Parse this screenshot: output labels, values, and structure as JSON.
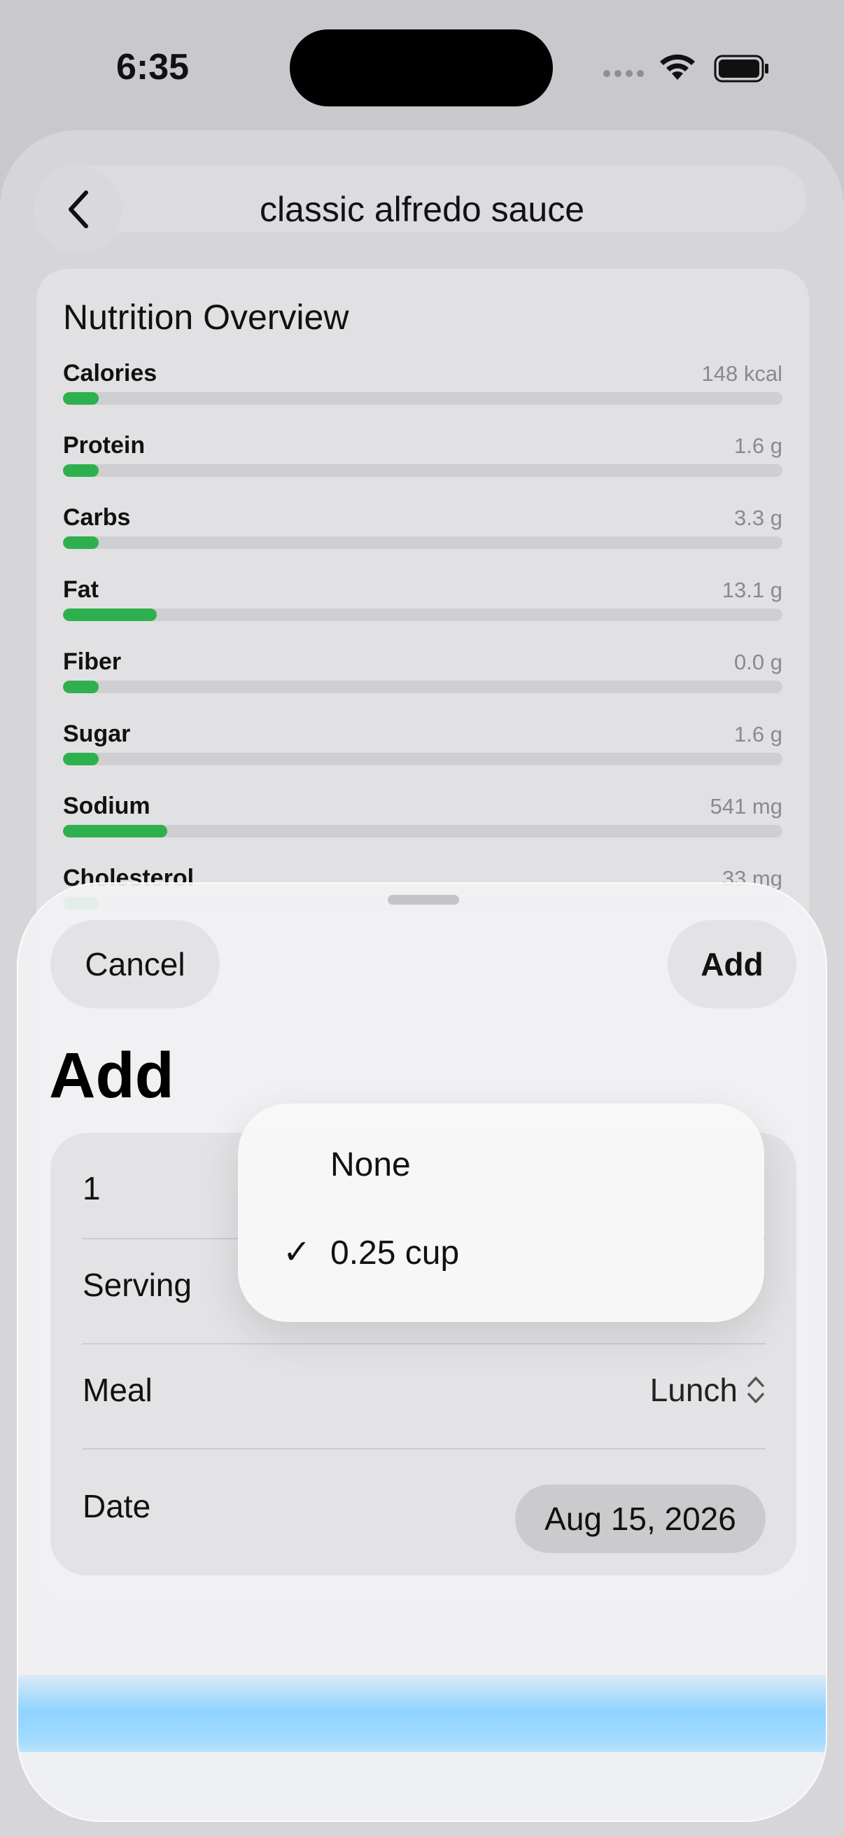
{
  "status_bar": {
    "time": "6:35"
  },
  "header": {
    "title": "classic alfredo sauce",
    "back_icon": "chevron-left-icon"
  },
  "nutrition": {
    "title": "Nutrition Overview",
    "rows": [
      {
        "label": "Calories",
        "value": "148 kcal",
        "fill": 0.05
      },
      {
        "label": "Protein",
        "value": "1.6 g",
        "fill": 0.05
      },
      {
        "label": "Carbs",
        "value": "3.3 g",
        "fill": 0.05
      },
      {
        "label": "Fat",
        "value": "13.1 g",
        "fill": 0.13
      },
      {
        "label": "Fiber",
        "value": "0.0 g",
        "fill": 0.05
      },
      {
        "label": "Sugar",
        "value": "1.6 g",
        "fill": 0.05
      },
      {
        "label": "Sodium",
        "value": "541 mg",
        "fill": 0.145
      },
      {
        "label": "Cholesterol",
        "value": "33 mg",
        "fill": 0.05
      }
    ],
    "bar_color": "#2fb04e"
  },
  "sheet": {
    "cancel_label": "Cancel",
    "add_label": "Add",
    "title": "Add",
    "form": {
      "quantity": "1",
      "serving_label": "Serving",
      "meal_label": "Meal",
      "meal_value": "Lunch",
      "date_label": "Date",
      "date_value": "Aug 15, 2026"
    }
  },
  "serving_menu": {
    "options": [
      {
        "label": "None",
        "selected": false
      },
      {
        "label": "0.25 cup",
        "selected": true
      }
    ],
    "check_glyph": "✓"
  }
}
